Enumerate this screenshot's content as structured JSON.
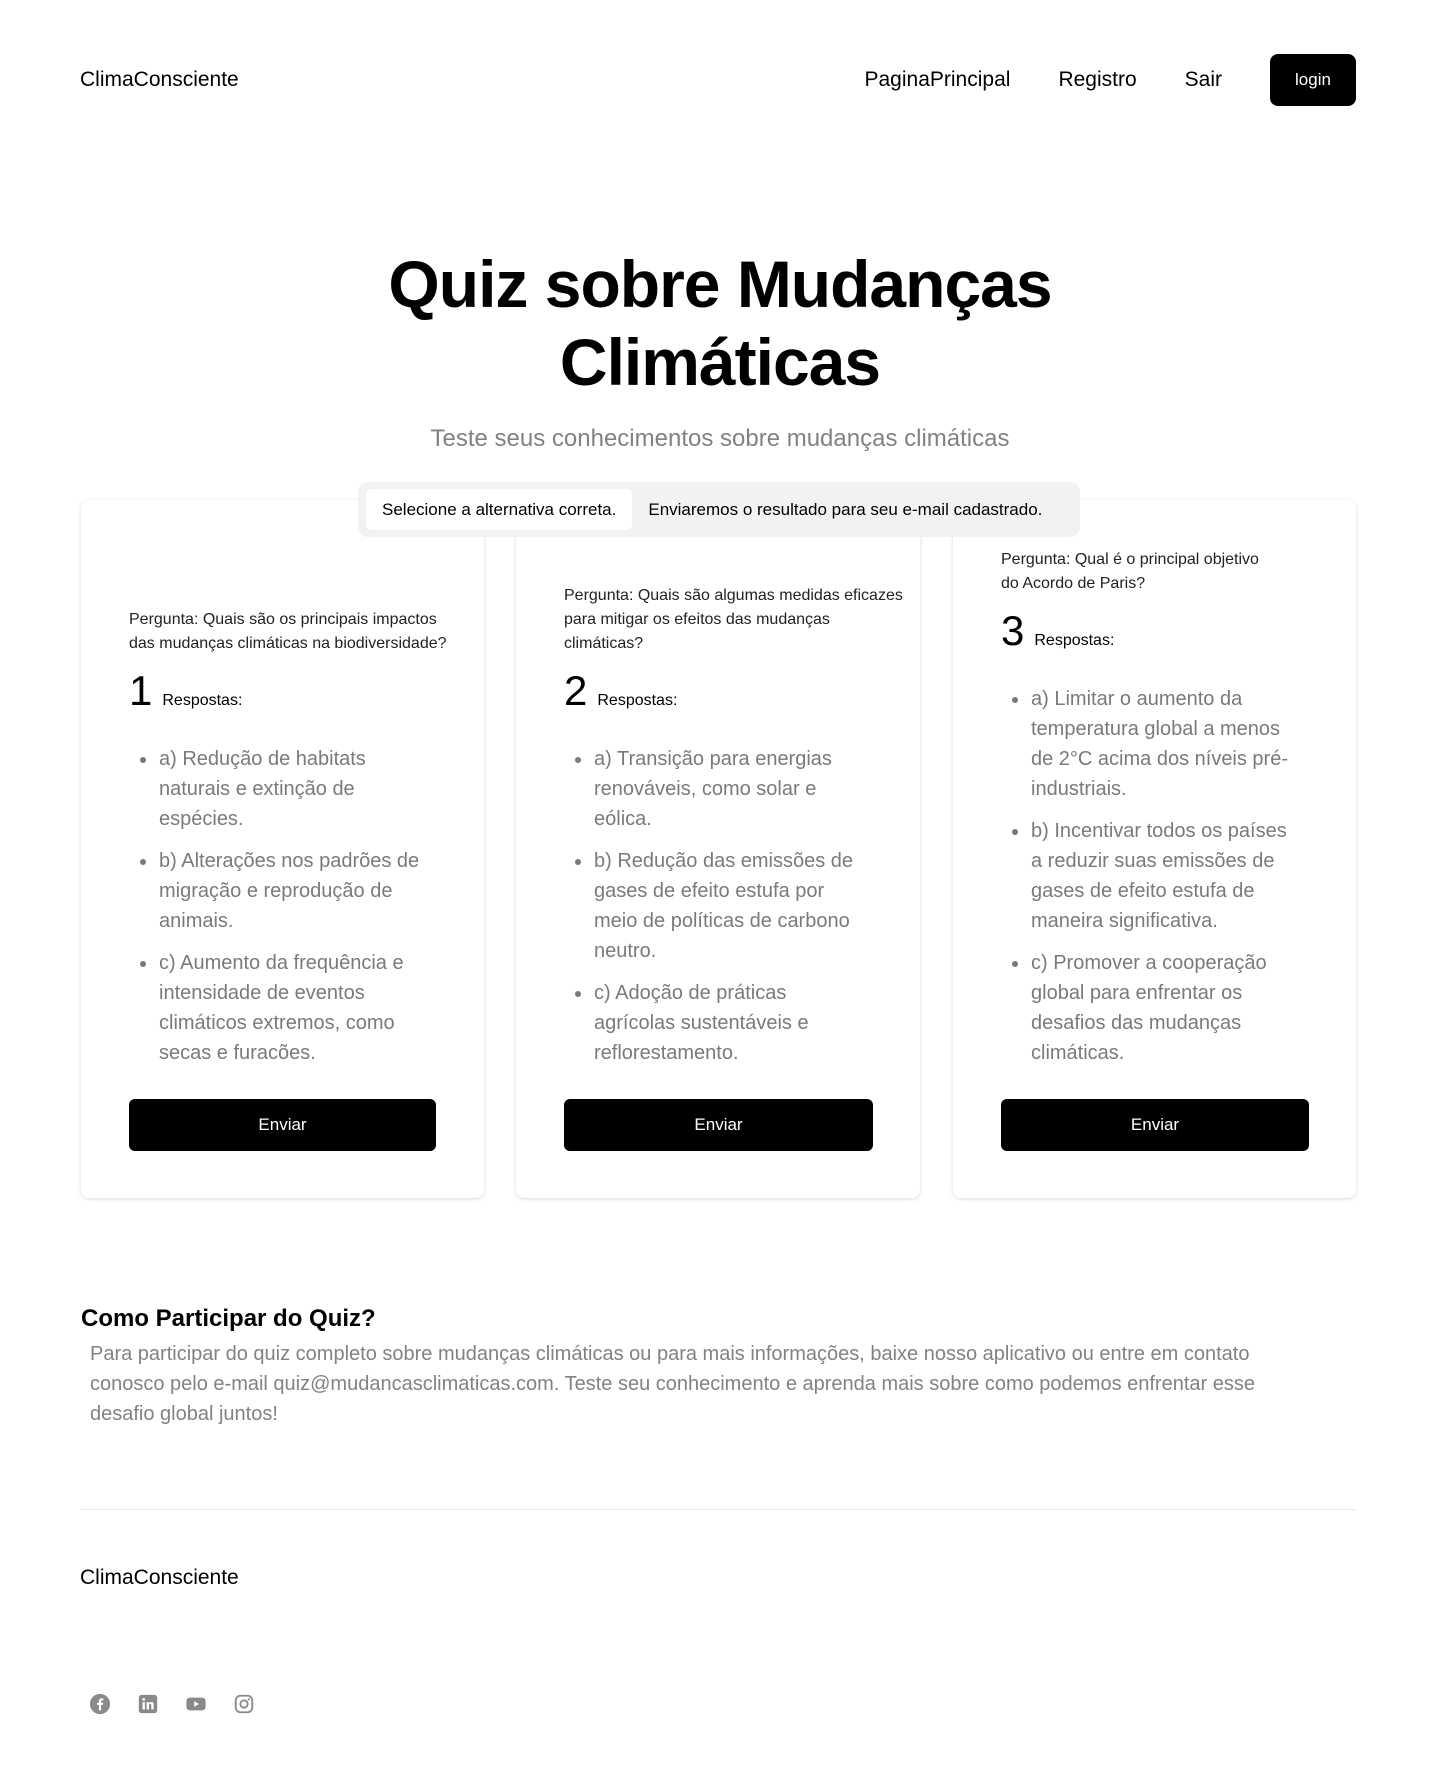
{
  "header": {
    "brand": "ClimaConsciente",
    "nav": [
      "PaginaPrincipal",
      "Registro",
      "Sair"
    ],
    "login_label": "login"
  },
  "hero": {
    "title_line1": "Quiz sobre Mudanças",
    "title_line2": "Climáticas",
    "subtitle": "Teste seus conhecimentos sobre mudanças climáticas"
  },
  "tabs": [
    "Selecione a alternativa correta.",
    "Enviaremos o resultado para seu e-mail cadastrado."
  ],
  "cards": [
    {
      "question": "Pergunta: Quais são os principais impactos\ndas mudanças climáticas na biodiversidade?",
      "number": "1",
      "answers_label": "Respostas:",
      "answers": [
        "a) Redução de habitats naturais e extinção de espécies.",
        "b) Alterações nos padrões de migração e reprodução de animais.",
        "c) Aumento da frequência e intensidade de eventos climáticos extremos, como secas e furacões."
      ],
      "button": "Enviar"
    },
    {
      "question": "Pergunta: Quais são algumas medidas eficazes\n para mitigar os efeitos das mudanças\nclimáticas?",
      "number": "2",
      "answers_label": "Respostas:",
      "answers": [
        "a) Transição para energias renováveis, como solar e eólica.",
        "b) Redução das emissões de gases de efeito estufa por meio de políticas de carbono neutro.",
        "c) Adoção de práticas agrícolas sustentáveis e reflorestamento."
      ],
      "button": "Enviar"
    },
    {
      "question": "Pergunta: Qual é o principal objetivo\n do Acordo de Paris?",
      "number": "3",
      "answers_label": "Respostas:",
      "answers": [
        "a) Limitar o aumento da temperatura global a menos de 2°C acima dos níveis pré-industriais.",
        "b) Incentivar todos os países a reduzir suas emissões de gases de efeito estufa de maneira significativa.",
        "c) Promover a cooperação global para enfrentar os desafios das mudanças climáticas."
      ],
      "button": "Enviar"
    }
  ],
  "info": {
    "title": "Como Participar do Quiz?",
    "text": "Para participar do quiz completo sobre mudanças climáticas ou para mais informações, baixe nosso aplicativo ou entre em contato conosco pelo e-mail quiz@mudancasclimaticas.com. Teste seu conhecimento e aprenda mais sobre como podemos enfrentar esse desafio global juntos!"
  },
  "footer": {
    "brand": "ClimaConsciente",
    "socials": [
      "facebook-icon",
      "linkedin-icon",
      "youtube-icon",
      "instagram-icon"
    ],
    "icon_color": "#8a8a8a"
  }
}
